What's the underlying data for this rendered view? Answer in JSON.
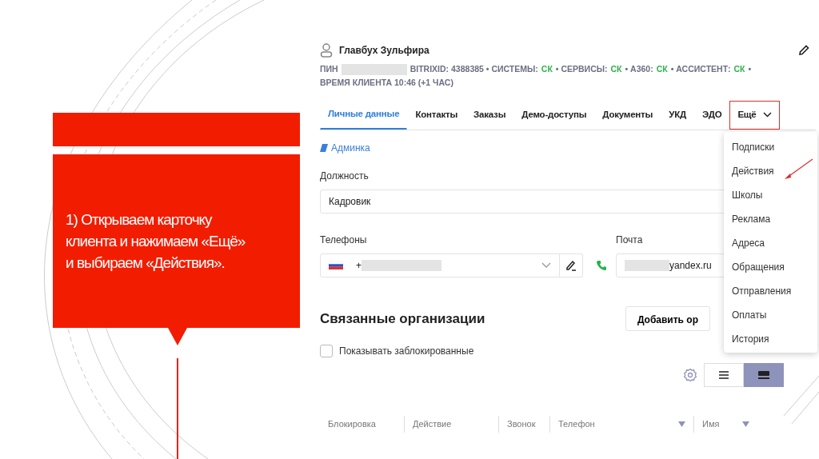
{
  "slide": {
    "caption": "1) Открываем карточку клиента и нажимаем «Ещё» и выбираем «Действия»."
  },
  "card": {
    "name": "Главбух Зульфира",
    "meta": [
      {
        "kind": "label",
        "text": "ПИН"
      },
      {
        "kind": "redacted"
      },
      {
        "kind": "label",
        "text": "BITRIXID: 4388385 • СИСТЕМЫ:"
      },
      {
        "kind": "status",
        "text": "СК"
      },
      {
        "kind": "label",
        "text": "• СЕРВИСЫ:"
      },
      {
        "kind": "status",
        "text": "СК"
      },
      {
        "kind": "label",
        "text": "• А360:"
      },
      {
        "kind": "status",
        "text": "СК"
      },
      {
        "kind": "label",
        "text": "• АССИСТЕНТ:"
      },
      {
        "kind": "status",
        "text": "СК"
      },
      {
        "kind": "label",
        "text": "•"
      },
      {
        "kind": "label",
        "text": "ВРЕМЯ КЛИЕНТА 10:46 (+1 ЧАС)"
      }
    ],
    "tabs": [
      {
        "label": "Личные данные",
        "selected": true,
        "highlighted": false,
        "dropdown": false
      },
      {
        "label": "Контакты",
        "selected": false,
        "highlighted": false,
        "dropdown": false
      },
      {
        "label": "Заказы",
        "selected": false,
        "highlighted": false,
        "dropdown": false
      },
      {
        "label": "Демо-доступы",
        "selected": false,
        "highlighted": false,
        "dropdown": false
      },
      {
        "label": "Документы",
        "selected": false,
        "highlighted": false,
        "dropdown": false
      },
      {
        "label": "УКД",
        "selected": false,
        "highlighted": false,
        "dropdown": false
      },
      {
        "label": "ЭДО",
        "selected": false,
        "highlighted": false,
        "dropdown": false
      },
      {
        "label": "Ещё",
        "selected": false,
        "highlighted": true,
        "dropdown": true
      }
    ],
    "menu": {
      "items": [
        {
          "label": "Подписки",
          "pointed": false
        },
        {
          "label": "Действия",
          "pointed": true
        },
        {
          "label": "Школы",
          "pointed": false
        },
        {
          "label": "Реклама",
          "pointed": false
        },
        {
          "label": "Адреса",
          "pointed": false
        },
        {
          "label": "Обращения",
          "pointed": false
        },
        {
          "label": "Отправления",
          "pointed": false
        },
        {
          "label": "Оплаты",
          "pointed": false
        },
        {
          "label": "История",
          "pointed": false
        }
      ]
    },
    "admin_link": "Админка",
    "position": {
      "label": "Должность",
      "value": "Кадровик"
    },
    "phones": {
      "label": "Телефоны",
      "value": "+"
    },
    "email": {
      "label": "Почта",
      "value": "yandex.ru"
    },
    "related": {
      "title": "Связанные организации",
      "add_button": "Добавить ор",
      "show_blocked": {
        "label": "Показывать заблокированные",
        "checked": false
      },
      "view_modes": [
        {
          "kind": "list",
          "selected": false
        },
        {
          "kind": "cards",
          "selected": true
        }
      ],
      "columns": [
        {
          "label": "Блокировка"
        },
        {
          "label": "Действие"
        },
        {
          "label": "Звонок"
        },
        {
          "label": "Телефон",
          "filter": true
        },
        {
          "label": "Имя",
          "filter": true
        }
      ]
    }
  }
}
